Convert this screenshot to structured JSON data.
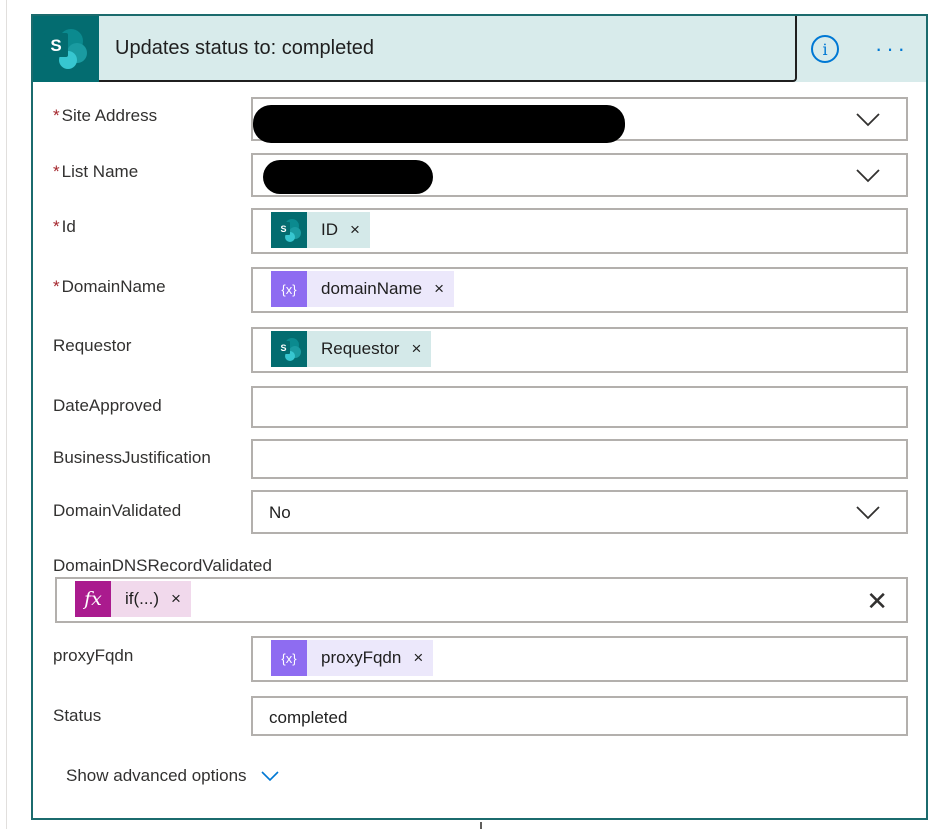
{
  "header": {
    "title": "Updates status to: completed",
    "logo_letter": "S",
    "info_glyph": "i",
    "more_glyph": "···",
    "icons": {
      "logo": "sharepoint-icon",
      "info": "info-icon",
      "more": "more-icon"
    }
  },
  "fields": {
    "site_address": {
      "label": "Site Address",
      "required_mark": "*",
      "value": "",
      "redacted": true
    },
    "list_name": {
      "label": "List Name",
      "required_mark": "*",
      "value": "",
      "redacted": true
    },
    "id": {
      "label": "Id",
      "required_mark": "*",
      "token": {
        "text": "ID",
        "icon": "sharepoint-icon"
      }
    },
    "domain_name": {
      "label": "DomainName",
      "required_mark": "*",
      "token": {
        "text": "domainName",
        "icon": "variable-icon"
      }
    },
    "requestor": {
      "label": "Requestor",
      "token": {
        "text": "Requestor",
        "icon": "sharepoint-icon"
      }
    },
    "date_approved": {
      "label": "DateApproved",
      "value": ""
    },
    "business_justification": {
      "label": "BusinessJustification",
      "value": ""
    },
    "domain_validated": {
      "label": "DomainValidated",
      "value": "No"
    },
    "domain_dns_record_validated": {
      "label": "DomainDNSRecordValidated",
      "token": {
        "text": "if(...)",
        "icon": "function-icon",
        "glyph": "fx"
      }
    },
    "proxy_fqdn": {
      "label": "proxyFqdn",
      "token": {
        "text": "proxyFqdn",
        "icon": "variable-icon"
      }
    },
    "status": {
      "label": "Status",
      "value": "completed"
    }
  },
  "token_close_glyph": "×",
  "clear_glyph": "✕",
  "variable_glyph": "{x}",
  "advanced_options": {
    "label": "Show advanced options"
  },
  "colors": {
    "card_border": "#1b6b6d",
    "header_bg": "#d8ebeb",
    "sharepoint": "#036c70",
    "accent": "#0078d4",
    "required": "#a4262c",
    "variable": "#8e6cf1",
    "function": "#aa1b8e"
  }
}
